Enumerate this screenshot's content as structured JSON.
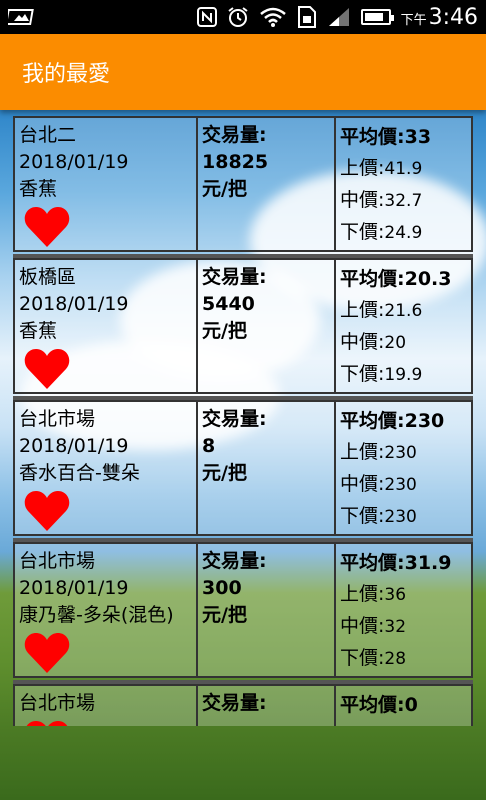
{
  "status_bar": {
    "ampm": "下午",
    "time": "3:46",
    "icons": [
      "image-icon",
      "nfc-icon",
      "alarm-icon",
      "wifi-icon",
      "sim-icon",
      "signal-icon",
      "battery-icon"
    ]
  },
  "app_bar": {
    "title": "我的最愛"
  },
  "colors": {
    "accent": "#FB8C00",
    "heart": "#FF0000"
  },
  "favorites": [
    {
      "market": "台北二",
      "date": "2018/01/19",
      "product": "香蕉",
      "volume_label": "交易量:",
      "volume": "18825",
      "unit": "元/把",
      "avg_label": "平均價:",
      "avg": "33",
      "high_label": "上價:",
      "high": "41.9",
      "mid_label": "中價:",
      "mid": "32.7",
      "low_label": "下價:",
      "low": "24.9"
    },
    {
      "market": "板橋區",
      "date": "2018/01/19",
      "product": "香蕉",
      "volume_label": "交易量:",
      "volume": "5440",
      "unit": "元/把",
      "avg_label": "平均價:",
      "avg": "20.3",
      "high_label": "上價:",
      "high": "21.6",
      "mid_label": "中價:",
      "mid": "20",
      "low_label": "下價:",
      "low": "19.9"
    },
    {
      "market": "台北市場",
      "date": "2018/01/19",
      "product": "香水百合-雙朵",
      "volume_label": "交易量:",
      "volume": "8",
      "unit": "元/把",
      "avg_label": "平均價:",
      "avg": "230",
      "high_label": "上價:",
      "high": "230",
      "mid_label": "中價:",
      "mid": "230",
      "low_label": "下價:",
      "low": "230"
    },
    {
      "market": "台北市場",
      "date": "2018/01/19",
      "product": "康乃馨-多朵(混色)",
      "volume_label": "交易量:",
      "volume": "300",
      "unit": "元/把",
      "avg_label": "平均價:",
      "avg": "31.9",
      "high_label": "上價:",
      "high": "36",
      "mid_label": "中價:",
      "mid": "32",
      "low_label": "下價:",
      "low": "28"
    },
    {
      "market": "台北市場",
      "date": "",
      "product": "",
      "volume_label": "交易量:",
      "volume": "",
      "unit": "",
      "avg_label": "平均價:",
      "avg": "0",
      "high_label": "",
      "high": "",
      "mid_label": "",
      "mid": "",
      "low_label": "",
      "low": ""
    }
  ]
}
